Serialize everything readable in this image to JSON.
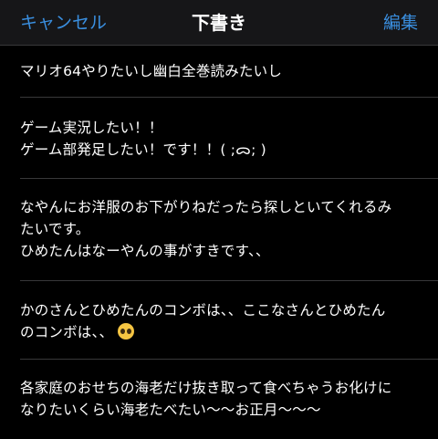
{
  "nav": {
    "cancel_label": "キャンセル",
    "title": "下書き",
    "edit_label": "編集"
  },
  "drafts": [
    {
      "lines": [
        "マリオ64やりたいし幽白全巻読みたいし"
      ]
    },
    {
      "lines": [
        "ゲーム実況したい！！",
        "ゲーム部発足したい！です！！( ;ᯅ; )"
      ]
    },
    {
      "lines": [
        "なやんにお洋服のお下がりねだったら探しといてくれるみ",
        "たいです。",
        "ひめたんはなーやんの事がすきです、、"
      ]
    },
    {
      "lines": [
        "かのさんとひめたんのコンボは、、ここなさんとひめたん",
        "のコンボは、、"
      ],
      "emoji": "pleading-face-emoji"
    },
    {
      "lines": [
        "各家庭のおせちの海老だけ抜き取って食べちゃうお化けに",
        "なりたいくらい海老たべたい〜〜お正月〜〜〜"
      ]
    }
  ],
  "colors": {
    "accent": "#3a8fe0",
    "background": "#000000",
    "nav_background": "#161618",
    "separator": "#38383a",
    "text": "#ffffff"
  }
}
